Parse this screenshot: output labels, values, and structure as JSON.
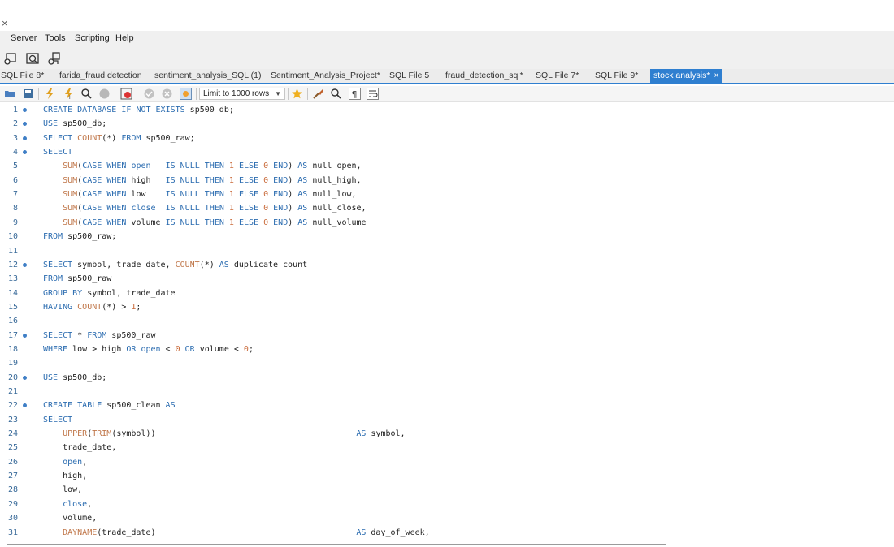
{
  "window": {
    "close_glyph": "×"
  },
  "menu": [
    "Server",
    "Tools",
    "Scripting",
    "Help"
  ],
  "toolbar_icons": [
    "new-connection-icon",
    "inspect-icon",
    "migrate-icon"
  ],
  "tabs": [
    {
      "label": "SQL File 8*",
      "active": false
    },
    {
      "label": "farida_fraud detection",
      "active": false
    },
    {
      "label": "sentiment_analysis_SQL (1)",
      "active": false
    },
    {
      "label": "Sentiment_Analysis_Project*",
      "active": false
    },
    {
      "label": "SQL File 5",
      "active": false
    },
    {
      "label": "fraud_detection_sql*",
      "active": false
    },
    {
      "label": "SQL File 7*",
      "active": false
    },
    {
      "label": "SQL File 9*",
      "active": false
    },
    {
      "label": "stock analysis*",
      "active": true,
      "close": "×"
    }
  ],
  "editor_toolbar": {
    "limit_label": "Limit to 1000 rows"
  },
  "editor": {
    "lines": [
      {
        "n": "1",
        "dot": true,
        "code": "CREATE DATABASE IF NOT EXISTS sp500_db;"
      },
      {
        "n": "2",
        "dot": true,
        "code": "USE sp500_db;"
      },
      {
        "n": "3",
        "dot": true,
        "code": "SELECT COUNT(*) FROM sp500_raw;"
      },
      {
        "n": "4",
        "dot": true,
        "code": "SELECT"
      },
      {
        "n": "5",
        "dot": false,
        "code": "    SUM(CASE WHEN open   IS NULL THEN 1 ELSE 0 END) AS null_open,"
      },
      {
        "n": "6",
        "dot": false,
        "code": "    SUM(CASE WHEN high   IS NULL THEN 1 ELSE 0 END) AS null_high,"
      },
      {
        "n": "7",
        "dot": false,
        "code": "    SUM(CASE WHEN low    IS NULL THEN 1 ELSE 0 END) AS null_low,"
      },
      {
        "n": "8",
        "dot": false,
        "code": "    SUM(CASE WHEN close  IS NULL THEN 1 ELSE 0 END) AS null_close,"
      },
      {
        "n": "9",
        "dot": false,
        "code": "    SUM(CASE WHEN volume IS NULL THEN 1 ELSE 0 END) AS null_volume"
      },
      {
        "n": "10",
        "dot": false,
        "code": "FROM sp500_raw;"
      },
      {
        "n": "11",
        "dot": false,
        "code": ""
      },
      {
        "n": "12",
        "dot": true,
        "code": "SELECT symbol, trade_date, COUNT(*) AS duplicate_count"
      },
      {
        "n": "13",
        "dot": false,
        "code": "FROM sp500_raw"
      },
      {
        "n": "14",
        "dot": false,
        "code": "GROUP BY symbol, trade_date"
      },
      {
        "n": "15",
        "dot": false,
        "code": "HAVING COUNT(*) > 1;"
      },
      {
        "n": "16",
        "dot": false,
        "code": ""
      },
      {
        "n": "17",
        "dot": true,
        "code": "SELECT * FROM sp500_raw"
      },
      {
        "n": "18",
        "dot": false,
        "code": "WHERE low > high OR open < 0 OR volume < 0;"
      },
      {
        "n": "19",
        "dot": false,
        "code": ""
      },
      {
        "n": "20",
        "dot": true,
        "code": "USE sp500_db;"
      },
      {
        "n": "21",
        "dot": false,
        "code": ""
      },
      {
        "n": "22",
        "dot": true,
        "code": "CREATE TABLE sp500_clean AS"
      },
      {
        "n": "23",
        "dot": false,
        "code": "SELECT"
      },
      {
        "n": "24",
        "dot": false,
        "code": "    UPPER(TRIM(symbol))                                         AS symbol,"
      },
      {
        "n": "25",
        "dot": false,
        "code": "    trade_date,"
      },
      {
        "n": "26",
        "dot": false,
        "code": "    open,"
      },
      {
        "n": "27",
        "dot": false,
        "code": "    high,"
      },
      {
        "n": "28",
        "dot": false,
        "code": "    low,"
      },
      {
        "n": "29",
        "dot": false,
        "code": "    close,"
      },
      {
        "n": "30",
        "dot": false,
        "code": "    volume,"
      },
      {
        "n": "31",
        "dot": false,
        "code": "    DAYNAME(trade_date)                                         AS day_of_week,"
      }
    ]
  }
}
